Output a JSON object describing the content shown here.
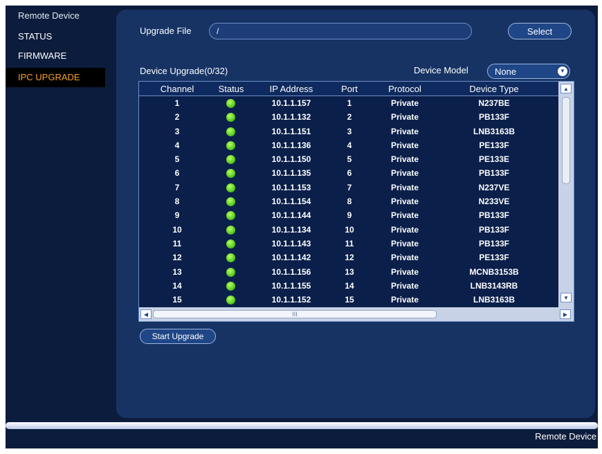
{
  "sidebar": {
    "title": "Remote Device",
    "items": [
      {
        "label": "STATUS",
        "active": false
      },
      {
        "label": "FIRMWARE",
        "active": false
      },
      {
        "label": "IPC UPGRADE",
        "active": true
      }
    ]
  },
  "upgrade": {
    "file_label": "Upgrade File",
    "file_value": "/",
    "select_label": "Select",
    "device_upgrade_label": "Device Upgrade(0/32)",
    "device_model_label": "Device Model",
    "device_model_value": "None",
    "start_label": "Start Upgrade"
  },
  "table": {
    "columns": [
      "Channel",
      "Status",
      "IP Address",
      "Port",
      "Protocol",
      "Device Type"
    ],
    "rows": [
      {
        "channel": "1",
        "status": "online",
        "ip": "10.1.1.157",
        "port": "1",
        "protocol": "Private",
        "type": "N237BE"
      },
      {
        "channel": "2",
        "status": "online",
        "ip": "10.1.1.132",
        "port": "2",
        "protocol": "Private",
        "type": "PB133F"
      },
      {
        "channel": "3",
        "status": "online",
        "ip": "10.1.1.151",
        "port": "3",
        "protocol": "Private",
        "type": "LNB3163B"
      },
      {
        "channel": "4",
        "status": "online",
        "ip": "10.1.1.136",
        "port": "4",
        "protocol": "Private",
        "type": "PE133F"
      },
      {
        "channel": "5",
        "status": "online",
        "ip": "10.1.1.150",
        "port": "5",
        "protocol": "Private",
        "type": "PE133E"
      },
      {
        "channel": "6",
        "status": "online",
        "ip": "10.1.1.135",
        "port": "6",
        "protocol": "Private",
        "type": "PB133F"
      },
      {
        "channel": "7",
        "status": "online",
        "ip": "10.1.1.153",
        "port": "7",
        "protocol": "Private",
        "type": "N237VE"
      },
      {
        "channel": "8",
        "status": "online",
        "ip": "10.1.1.154",
        "port": "8",
        "protocol": "Private",
        "type": "N233VE"
      },
      {
        "channel": "9",
        "status": "online",
        "ip": "10.1.1.144",
        "port": "9",
        "protocol": "Private",
        "type": "PB133F"
      },
      {
        "channel": "10",
        "status": "online",
        "ip": "10.1.1.134",
        "port": "10",
        "protocol": "Private",
        "type": "PB133F"
      },
      {
        "channel": "11",
        "status": "online",
        "ip": "10.1.1.143",
        "port": "11",
        "protocol": "Private",
        "type": "PB133F"
      },
      {
        "channel": "12",
        "status": "online",
        "ip": "10.1.1.142",
        "port": "12",
        "protocol": "Private",
        "type": "PE133F"
      },
      {
        "channel": "13",
        "status": "online",
        "ip": "10.1.1.156",
        "port": "13",
        "protocol": "Private",
        "type": "MCNB3153B"
      },
      {
        "channel": "14",
        "status": "online",
        "ip": "10.1.1.155",
        "port": "14",
        "protocol": "Private",
        "type": "LNB3143RB"
      },
      {
        "channel": "15",
        "status": "online",
        "ip": "10.1.1.152",
        "port": "15",
        "protocol": "Private",
        "type": "LNB3163B"
      }
    ],
    "hscroll_grip": "III"
  },
  "footer": {
    "label": "Remote Device"
  },
  "colors": {
    "background": "#0c1c3c",
    "panel": "#163364",
    "active_text": "#f2a12a",
    "status_online": "#4cc21a"
  }
}
